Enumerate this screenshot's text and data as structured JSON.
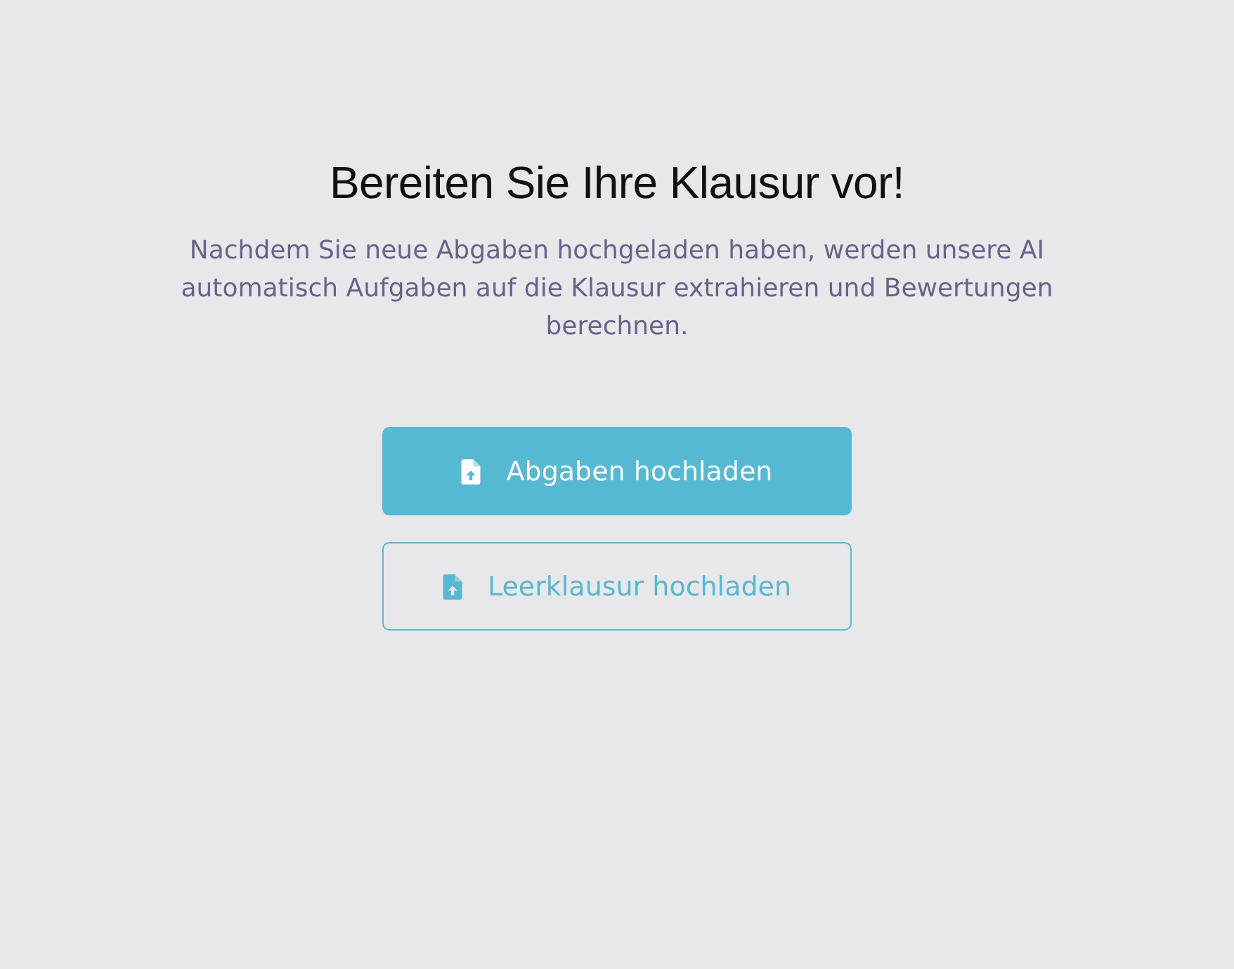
{
  "title": "Bereiten Sie Ihre Klausur vor!",
  "description": "Nachdem Sie neue Abgaben hochgeladen haben, werden unsere AI automatisch Aufgaben auf die Klausur extrahieren und Bewertungen berechnen.",
  "buttons": [
    {
      "label": "Abgaben hochladen",
      "kind": "primary"
    },
    {
      "label": "Leerklausur hochladen",
      "kind": "outline"
    }
  ]
}
